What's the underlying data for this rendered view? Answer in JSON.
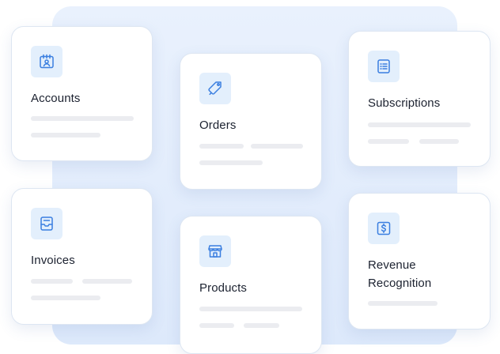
{
  "cards": {
    "accounts": {
      "label": "Accounts",
      "icon": "calendar-user-icon"
    },
    "orders": {
      "label": "Orders",
      "icon": "tag-icon"
    },
    "subscriptions": {
      "label": "Subscriptions",
      "icon": "list-icon"
    },
    "invoices": {
      "label": "Invoices",
      "icon": "inbox-tray-icon"
    },
    "products": {
      "label": "Products",
      "icon": "storefront-icon"
    },
    "revenue_recognition": {
      "label": "Revenue\nRecognition",
      "icon": "dollar-bill-icon"
    }
  },
  "colors": {
    "accent": "#3b7fe0",
    "icon_background": "#e3effc",
    "backdrop": "#e5eefc",
    "placeholder_bar": "#ebecf0"
  }
}
